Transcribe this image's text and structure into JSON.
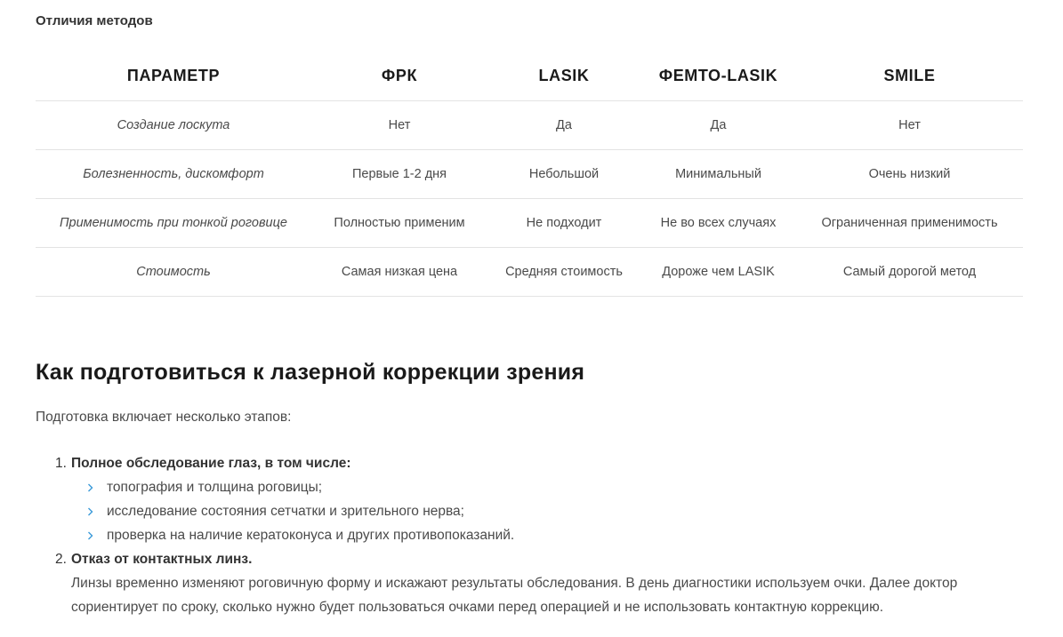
{
  "table": {
    "caption": "Отличия методов",
    "headers": [
      "ПАРАМЕТР",
      "ФРК",
      "LASIK",
      "ФЕМТО-LASIK",
      "SMILE"
    ],
    "rows": [
      [
        "Создание лоскута",
        "Нет",
        "Да",
        "Да",
        "Нет"
      ],
      [
        "Болезненность, дискомфорт",
        "Первые 1-2 дня",
        "Небольшой",
        "Минимальный",
        "Очень низкий"
      ],
      [
        "Применимость при тонкой роговице",
        "Полностью применим",
        "Не подходит",
        "Не во всех случаях",
        "Ограниченная применимость"
      ],
      [
        "Стоимость",
        "Самая низкая цена",
        "Средняя стоимость",
        "Дороже чем LASIK",
        "Самый дорогой метод"
      ]
    ]
  },
  "section": {
    "title": "Как подготовиться к лазерной коррекции зрения",
    "intro": "Подготовка включает несколько этапов:",
    "steps": [
      {
        "number": "1.",
        "title": "Полное обследование глаз, в том числе:",
        "items": [
          "топография и толщина роговицы;",
          "исследование состояния сетчатки и зрительного нерва;",
          "проверка на наличие кератоконуса и других противопоказаний."
        ]
      },
      {
        "number": "2.",
        "title": "Отказ от контактных линз.",
        "description": "Линзы временно изменяют роговичную форму и искажают результаты обследования. В день диагностики используем очки. Далее доктор сориентирует по сроку, сколько нужно будет пользоваться очками перед операцией и не использовать контактную коррекцию."
      }
    ]
  },
  "colors": {
    "accent": "#3a9ad9",
    "divider": "#e3e3e3",
    "text": "#4a4a4a",
    "heading": "#1a1a1a"
  },
  "icons": {
    "bullet": "chevron-right-icon"
  }
}
